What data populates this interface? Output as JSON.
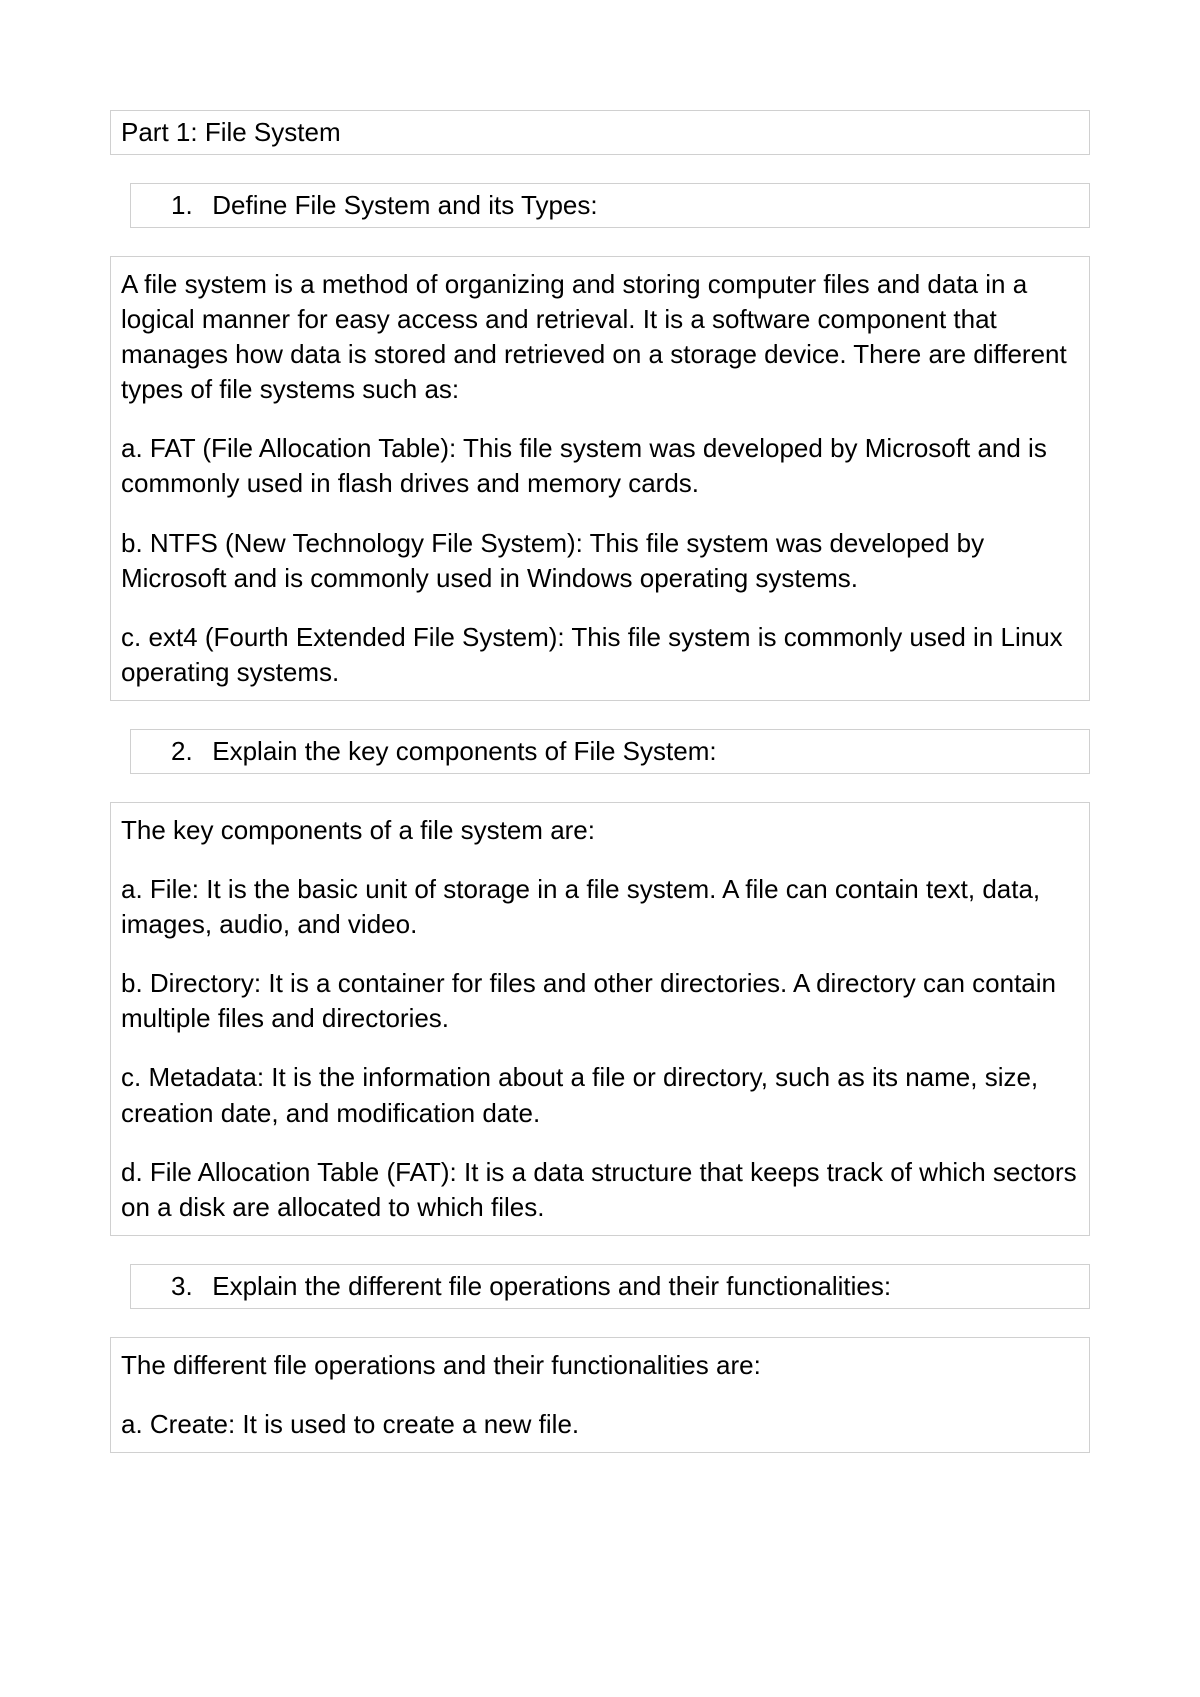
{
  "part_title": "Part 1: File System",
  "sections": [
    {
      "number": "1.",
      "heading": "Define File System and its Types:",
      "paragraphs": [
        "A file system is a method of organizing and storing computer files and data in a logical manner for easy access and retrieval. It is a software component that manages how data is stored and retrieved on a storage device. There are different types of file systems such as:",
        "a. FAT (File Allocation Table): This file system was developed by Microsoft and is commonly used in flash drives and memory cards.",
        "b. NTFS (New Technology File System): This file system was developed by Microsoft and is commonly used in Windows operating systems.",
        "c. ext4 (Fourth Extended File System): This file system is commonly used in Linux operating systems."
      ]
    },
    {
      "number": "2.",
      "heading": "Explain the key components of File System:",
      "paragraphs": [
        "The key components of a file system are:",
        "a. File: It is the basic unit of storage in a file system. A file can contain text, data, images, audio, and video.",
        "b. Directory: It is a container for files and other directories. A directory can contain multiple files and directories.",
        "c. Metadata: It is the information about a file or directory, such as its name, size, creation date, and modification date.",
        "d. File Allocation Table (FAT): It is a data structure that keeps track of which sectors on a disk are allocated to which files."
      ]
    },
    {
      "number": "3.",
      "heading": "Explain the different file operations and their functionalities:",
      "paragraphs": [
        "The different file operations and their functionalities are:",
        "a. Create: It is used to create a new file."
      ]
    }
  ]
}
